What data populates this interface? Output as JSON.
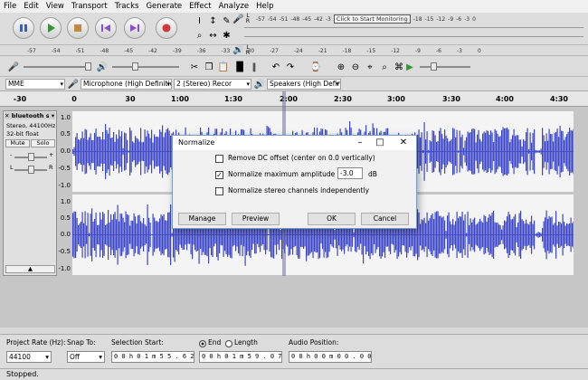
{
  "menu": [
    "File",
    "Edit",
    "View",
    "Transport",
    "Tracks",
    "Generate",
    "Effect",
    "Analyze",
    "Help"
  ],
  "transport": {
    "pause": "pause-icon",
    "play": "play-icon",
    "stop": "stop-icon",
    "skip_start": "skip-start-icon",
    "skip_end": "skip-end-icon",
    "record": "record-icon",
    "colors": {
      "play": "#2e9a2e",
      "record": "#d13a3a",
      "stop": "#c08a40",
      "skip": "#8a4fc8",
      "pause": "#3a5fb8"
    }
  },
  "meters": {
    "record_ticks": [
      "-57",
      "-54",
      "-51",
      "-48",
      "-45",
      "-42",
      "-3",
      "-18",
      "-15",
      "-12",
      "-9",
      "-6",
      "-3",
      "0"
    ],
    "record_prompt": "Click to Start Monitoring",
    "play_ticks": [
      "-57",
      "-54",
      "-51",
      "-48",
      "-45",
      "-42",
      "-39",
      "-36",
      "-33",
      "-30",
      "-27",
      "-24",
      "-21",
      "-18",
      "-15",
      "-12",
      "-9",
      "-6",
      "-3",
      "0"
    ],
    "left": "L",
    "right": "R"
  },
  "devices": {
    "host": "MME",
    "input": "Microphone (High Definitic",
    "channels": "2 (Stereo) Recor",
    "output": "Speakers (High Definition A"
  },
  "ruler": [
    "-30",
    "0",
    "30",
    "1:00",
    "1:30",
    "2:00",
    "2:30",
    "3:00",
    "3:30",
    "4:00",
    "4:30"
  ],
  "track": {
    "name": "bluetooth s",
    "info1": "Stereo, 44100Hz",
    "info2": "32-bit float",
    "mute": "Mute",
    "solo": "Solo",
    "minus": "-",
    "plus": "+",
    "left": "L",
    "right": "R",
    "collapse": "▲",
    "scale": [
      "1.0",
      "0.5",
      "0.0",
      "-0.5",
      "-1.0"
    ]
  },
  "dialog": {
    "title": "Normalize",
    "remove_dc": "Remove DC offset (center on 0.0 vertically)",
    "remove_dc_checked": false,
    "normalize_max": "Normalize maximum amplitude to",
    "normalize_max_checked": true,
    "amplitude": "-3.0",
    "unit": "dB",
    "stereo_indep": "Normalize stereo channels independently",
    "stereo_indep_checked": false,
    "manage": "Manage",
    "preview": "Preview",
    "ok": "OK",
    "cancel": "Cancel"
  },
  "selection": {
    "project_rate_label": "Project Rate (Hz):",
    "project_rate": "44100",
    "snap_label": "Snap To:",
    "snap": "Off",
    "start_label": "Selection Start:",
    "start": "0 0 h 0 1 m 5 5 . 6 2 9 s",
    "end_label": "End",
    "length_label": "Length",
    "end": "0 0 h 0 1 m 5 9 . 0 7 6 s",
    "audio_pos_label": "Audio Position:",
    "audio_pos": "0 0 h 0 0 m 0 0 . 0 0 0 s"
  },
  "status": "Stopped."
}
